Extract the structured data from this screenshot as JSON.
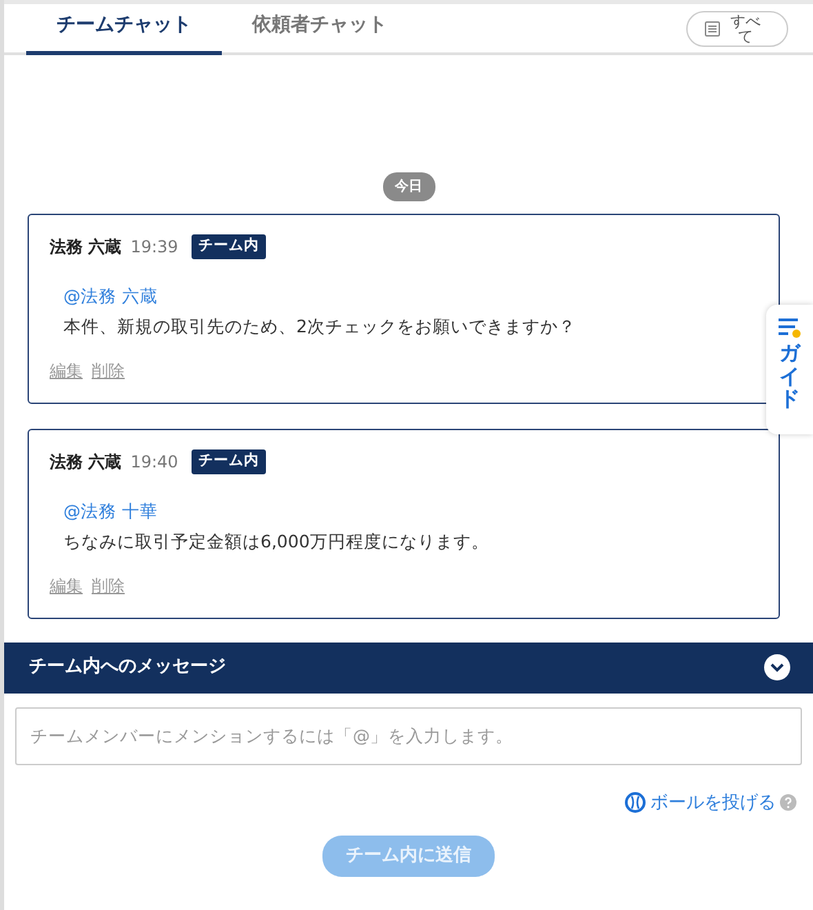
{
  "tabs": [
    {
      "label": "チームチャット",
      "selected": true
    },
    {
      "label": "依頼者チャット",
      "selected": false
    }
  ],
  "filter_button": {
    "label": "すべて"
  },
  "date_divider": "今日",
  "messages": [
    {
      "author": "法務 六蔵",
      "time": "19:39",
      "tag": "チーム内",
      "mention": "@法務 六蔵",
      "text": "本件、新規の取引先のため、2次チェックをお願いできますか？",
      "actions": [
        "編集",
        "削除"
      ]
    },
    {
      "author": "法務 六蔵",
      "time": "19:40",
      "tag": "チーム内",
      "mention": "@法務 十華",
      "text": "ちなみに取引予定金額は6,000万円程度になります。",
      "actions": [
        "編集",
        "削除"
      ]
    }
  ],
  "guide_tab": {
    "label": "ガイド"
  },
  "composer": {
    "title": "チーム内へのメッセージ",
    "expanded": true,
    "placeholder": "チームメンバーにメンションするには「@」を入力します。",
    "ball_link": "ボールを投げる",
    "send_button": {
      "label": "チーム内に送信",
      "disabled": true
    }
  }
}
